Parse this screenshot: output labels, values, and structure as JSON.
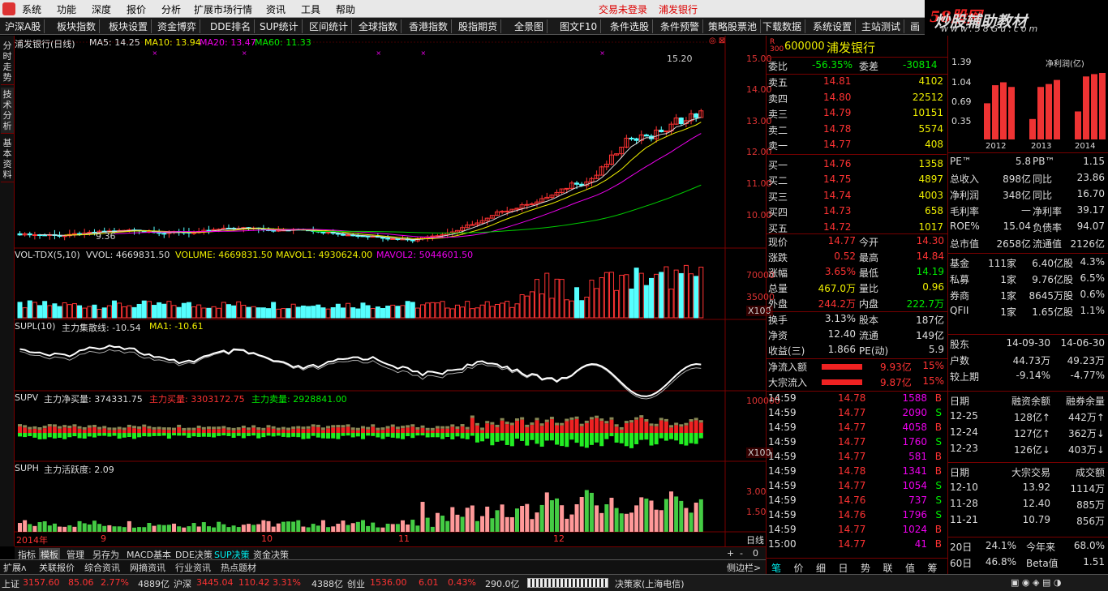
{
  "menu": {
    "items": [
      "系统",
      "功能",
      "深度",
      "报价",
      "分析",
      "扩展市场行情",
      "资讯",
      "工具",
      "帮助"
    ],
    "login": "交易未登录",
    "stock": "浦发银行"
  },
  "brand": {
    "cn": "炒股辅助教材",
    "num": "58股网",
    "url": "www.58Gu.com"
  },
  "toolbar": [
    "沪深A股",
    "板块指数",
    "板块设置",
    "资金博弈",
    "DDE排名",
    "SUP统计",
    "区间统计",
    "全球指数",
    "香港指数",
    "股指期货",
    "全景图",
    "图文F10",
    "条件选股",
    "条件预警",
    "策略股票池",
    "下载数据",
    "系统设置",
    "主站测试",
    "画"
  ],
  "lefttabs": [
    "分时走势",
    "技术分析",
    "基本资料"
  ],
  "chart": {
    "title": "浦发银行(日线)",
    "ma5": "MA5: 14.25",
    "ma10": "MA10: 13.94",
    "ma20": "MA20: 13.47",
    "ma60": "MA60: 11.33",
    "high": "15.20",
    "low": "9.36",
    "price_ticks": [
      "15.00",
      "14.00",
      "13.00",
      "12.00",
      "11.00",
      "10.00"
    ],
    "vol": {
      "name": "VOL-TDX(5,10)",
      "vvol": "VVOL: 4669831.50",
      "volume": "VOLUME: 4669831.50",
      "mavol1": "MAVOL1: 4930624.00",
      "mavol2": "MAVOL2: 5044601.50",
      "ticks": [
        "70000",
        "35000"
      ],
      "unit": "X100"
    },
    "supl": {
      "name": "SUPL(10)",
      "line": "主力集散线: -10.54",
      "ma1": "MA1: -10.61"
    },
    "supv": {
      "name": "SUPV",
      "net": "主力净买量: 374331.75",
      "buy": "主力买量: 3303172.75",
      "sell": "主力卖量: 2928841.00",
      "ticks": [
        "100000"
      ],
      "unit": "X100"
    },
    "suph": {
      "name": "SUPH",
      "act": "主力活跃度: 2.09",
      "ticks": [
        "3.00",
        "1.50"
      ]
    },
    "xaxis": [
      "2014年",
      "9",
      "10",
      "11",
      "12"
    ],
    "period": "日线"
  },
  "chart_data": {
    "type": "candlestick",
    "title": "浦发银行(日线)",
    "x_months": [
      "2014年",
      "9",
      "10",
      "11",
      "12"
    ],
    "y_ticks": [
      15.0,
      14.0,
      13.0,
      12.0,
      11.0,
      10.0
    ],
    "series": [
      {
        "name": "MA5",
        "value": 14.25
      },
      {
        "name": "MA10",
        "value": 13.94
      },
      {
        "name": "MA20",
        "value": 13.47
      },
      {
        "name": "MA60",
        "value": 11.33
      }
    ],
    "annotations": {
      "high": 15.2,
      "low": 9.36
    }
  },
  "bottomtabs": [
    "指标",
    "模板",
    "管理",
    "另存为",
    "MACD基本",
    "DDE决策",
    "SUP决策",
    "资金决策"
  ],
  "bottom2": [
    "扩展ʌ",
    "关联报价",
    "综合资讯",
    "网摘资讯",
    "行业资讯",
    "热点题材"
  ],
  "quote": {
    "code": "600000",
    "name": "浦发银行",
    "weibi_l": "委比",
    "weibi": "-56.35%",
    "weicha_l": "委差",
    "weicha": "-30814",
    "sells": [
      [
        "卖五",
        "14.81",
        "4102"
      ],
      [
        "卖四",
        "14.80",
        "22512"
      ],
      [
        "卖三",
        "14.79",
        "10151"
      ],
      [
        "卖二",
        "14.78",
        "5574"
      ],
      [
        "卖一",
        "14.77",
        "408"
      ]
    ],
    "buys": [
      [
        "买一",
        "14.76",
        "1358"
      ],
      [
        "买二",
        "14.75",
        "4897"
      ],
      [
        "买三",
        "14.74",
        "4003"
      ],
      [
        "买四",
        "14.73",
        "658"
      ],
      [
        "买五",
        "14.72",
        "1017"
      ]
    ],
    "stats": [
      [
        "现价",
        "14.77",
        "今开",
        "14.30"
      ],
      [
        "涨跌",
        "0.52",
        "最高",
        "14.84"
      ],
      [
        "涨幅",
        "3.65%",
        "最低",
        "14.19"
      ],
      [
        "总量",
        "467.0万",
        "量比",
        "0.96"
      ],
      [
        "外盘",
        "244.2万",
        "内盘",
        "222.7万"
      ]
    ],
    "stats2": [
      [
        "换手",
        "3.13%",
        "股本",
        "187亿"
      ],
      [
        "净资",
        "12.40",
        "流通",
        "149亿"
      ],
      [
        "收益(三)",
        "1.866",
        "PE(动)",
        "5.9"
      ]
    ],
    "flow": [
      [
        "净流入额",
        "9.93亿",
        "15%"
      ],
      [
        "大宗流入",
        "9.87亿",
        "15%"
      ]
    ],
    "ticks": [
      [
        "14:59",
        "14.78",
        "1588",
        "B"
      ],
      [
        "14:59",
        "14.77",
        "2090",
        "S"
      ],
      [
        "14:59",
        "14.77",
        "4058",
        "B"
      ],
      [
        "14:59",
        "14.77",
        "1760",
        "S"
      ],
      [
        "14:59",
        "14.77",
        "581",
        "B"
      ],
      [
        "14:59",
        "14.78",
        "1341",
        "B"
      ],
      [
        "14:59",
        "14.77",
        "1054",
        "S"
      ],
      [
        "14:59",
        "14.76",
        "737",
        "S"
      ],
      [
        "14:59",
        "14.76",
        "1796",
        "S"
      ],
      [
        "14:59",
        "14.77",
        "1024",
        "B"
      ],
      [
        "15:00",
        "14.77",
        "41",
        "B"
      ]
    ],
    "tabs": [
      "笔",
      "价",
      "细",
      "日",
      "势",
      "联",
      "值",
      "筹"
    ]
  },
  "fin": {
    "bar_labels": [
      "1.39",
      "1.04",
      "0.69",
      "0.35"
    ],
    "net_label": "净利润(亿)",
    "years": [
      "2012",
      "2013",
      "2014"
    ],
    "rows": [
      [
        "PE™",
        "5.8",
        "PB™",
        "1.15"
      ],
      [
        "总收入",
        "898亿",
        "同比",
        "23.86"
      ],
      [
        "净利润",
        "348亿",
        "同比",
        "16.70"
      ],
      [
        "毛利率",
        "—",
        "净利率",
        "39.17"
      ],
      [
        "ROE%",
        "15.04",
        "负债率",
        "94.07"
      ],
      [
        "总市值",
        "2658亿",
        "流通值",
        "2126亿"
      ]
    ],
    "inst": [
      [
        "基金",
        "111家",
        "6.40亿股",
        "4.3%"
      ],
      [
        "私募",
        "1家",
        "9.76亿股",
        "6.5%"
      ],
      [
        "券商",
        "1家",
        "8645万股",
        "0.6%"
      ],
      [
        "QFII",
        "1家",
        "1.65亿股",
        "1.1%"
      ]
    ],
    "holders": {
      "h": [
        "股东",
        "14-09-30",
        "14-06-30"
      ],
      "r1": [
        "户数",
        "44.73万",
        "49.23万"
      ],
      "r2": [
        "较上期",
        "-9.14%",
        "-4.77%"
      ]
    },
    "margin": {
      "h": [
        "日期",
        "融资余额",
        "融券余量"
      ],
      "rows": [
        [
          "12-25",
          "128亿↑",
          "442万↑"
        ],
        [
          "12-24",
          "127亿↑",
          "362万↓"
        ],
        [
          "12-23",
          "126亿↓",
          "403万↓"
        ]
      ]
    },
    "block": {
      "h": [
        "日期",
        "大宗交易",
        "成交额"
      ],
      "rows": [
        [
          "12-10",
          "13.92",
          "1114万"
        ],
        [
          "11-28",
          "12.40",
          "885万"
        ],
        [
          "11-21",
          "10.79",
          "856万"
        ]
      ]
    },
    "perf": [
      [
        "20日",
        "24.1%",
        "今年来",
        "68.0%"
      ],
      [
        "60日",
        "46.8%",
        "Beta值",
        "1.51"
      ]
    ]
  },
  "status": {
    "sh": "上证",
    "sh_v": "3157.60",
    "sh_c": "85.06",
    "sh_p": "2.77%",
    "sh_a": "4889亿",
    "hs": "沪深",
    "hs_v": "3445.04",
    "hs_c": "110.42",
    "hs_p": "3.31%",
    "hs_a": "4388亿",
    "cy": "创业",
    "cy_v": "1536.00",
    "cy_c": "6.01",
    "cy_p": "0.43%",
    "cy_a": "290.0亿",
    "srv": "决策家(上海电信)"
  }
}
